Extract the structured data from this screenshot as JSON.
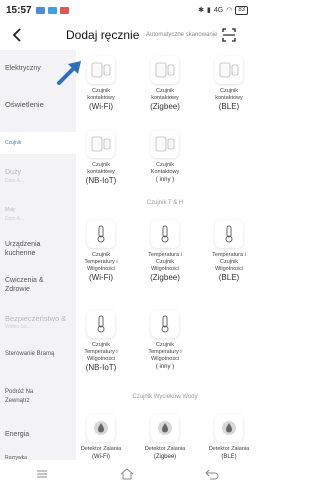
{
  "statusbar": {
    "time": "15:57",
    "right_text": "4G",
    "battery": "83"
  },
  "header": {
    "title": "Dodaj ręcznie",
    "autoscan_label": "Automatyczne skanowanie"
  },
  "sidebar": {
    "items": [
      {
        "label": "Elektryczny",
        "sub": ""
      },
      {
        "label": "Oświetlenie",
        "sub": ""
      },
      {
        "label": "Czujnik",
        "sub": ""
      },
      {
        "label": "Duży",
        "sub": "Dom A..."
      },
      {
        "label": "Mały",
        "sub": "Dom A..."
      },
      {
        "label": "Urządzenia kuchenne",
        "sub": ""
      },
      {
        "label": "Ćwiczenia & Zdrowie",
        "sub": ""
      },
      {
        "label": "Bezpieczeństwo &",
        "sub": "Wideo Su..."
      },
      {
        "label": "Sterowanie Bramą",
        "sub": ""
      },
      {
        "label": "Podróż Na Zewnątrz",
        "sub": ""
      },
      {
        "label": "Energia",
        "sub": ""
      },
      {
        "label": "Rozrywka",
        "sub": ""
      }
    ]
  },
  "sections": {
    "contact": {
      "cards": [
        {
          "label": "Czujnik kontaktowy",
          "sub": "(Wi-Fi)"
        },
        {
          "label": "Czujnik kontaktowy",
          "sub": "(Zigbee)"
        },
        {
          "label": "Czujnik kontaktowy",
          "sub": "(BLE)"
        },
        {
          "label": "Czujnik kontaktowy",
          "sub": "(NB-IoT)"
        },
        {
          "label": "Czujnik Kontaktowy",
          "sub": "( inny )"
        }
      ]
    },
    "temp": {
      "title": "Czujnik T & H",
      "cards": [
        {
          "label": "Czujnik Temperatury i Wilgotności",
          "sub": "(Wi-Fi)"
        },
        {
          "label": "Temperatura i Czujnik Wilgotności",
          "sub": "(Zigbee)"
        },
        {
          "label": "Temperatura i Czujnik Wilgotności",
          "sub": "(BLE)"
        },
        {
          "label": "Czujnik Temperatury i Wilgotności",
          "sub": "(NB-IoT)"
        },
        {
          "label": "Czujnik Temperatury i Wilgotności",
          "sub": "( inny )"
        }
      ]
    },
    "water": {
      "title": "Czujnik Wycieków Wody",
      "cards": [
        {
          "label": "Detektor Zalania",
          "sub": "(Wi-Fi)"
        },
        {
          "label": "Detektor Zalania",
          "sub": "(Zigbee)"
        },
        {
          "label": "Detektor Zalania",
          "sub": "(BLE)"
        }
      ]
    }
  },
  "colors": {
    "accent": "#3a86c8",
    "arrow": "#2a6fb8",
    "sidebar_bg": "#f3f3f5"
  }
}
